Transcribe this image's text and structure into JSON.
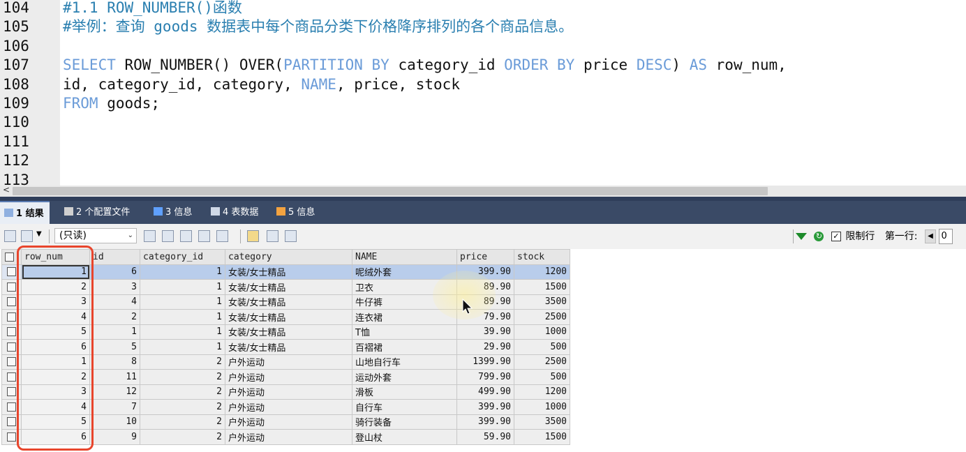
{
  "editor": {
    "lines": [
      {
        "num": "104",
        "parts": [
          {
            "t": "#1.1 ROW_NUMBER()函数",
            "c": "cm"
          }
        ]
      },
      {
        "num": "105",
        "parts": [
          {
            "t": "#举例：查询 goods 数据表中每个商品分类下价格降序排列的各个商品信息。",
            "c": "cm"
          }
        ]
      },
      {
        "num": "106",
        "parts": []
      },
      {
        "num": "107",
        "parts": [
          {
            "t": "SELECT",
            "c": "kw"
          },
          {
            "t": " ROW_NUMBER() OVER(",
            "c": "tx"
          },
          {
            "t": "PARTITION BY",
            "c": "kw"
          },
          {
            "t": " category_id ",
            "c": "tx"
          },
          {
            "t": "ORDER BY",
            "c": "kw"
          },
          {
            "t": " price ",
            "c": "tx"
          },
          {
            "t": "DESC",
            "c": "kw"
          },
          {
            "t": ") ",
            "c": "tx"
          },
          {
            "t": "AS",
            "c": "kw"
          },
          {
            "t": " row_num,",
            "c": "tx"
          }
        ]
      },
      {
        "num": "108",
        "parts": [
          {
            "t": "id, category_id, category, ",
            "c": "tx"
          },
          {
            "t": "NAME",
            "c": "kw"
          },
          {
            "t": ", price, stock",
            "c": "tx"
          }
        ]
      },
      {
        "num": "109",
        "parts": [
          {
            "t": "FROM",
            "c": "kw"
          },
          {
            "t": " goods;",
            "c": "tx"
          }
        ]
      },
      {
        "num": "110",
        "parts": []
      },
      {
        "num": "111",
        "parts": []
      },
      {
        "num": "112",
        "parts": []
      },
      {
        "num": "113",
        "parts": []
      }
    ]
  },
  "tabs": [
    {
      "label": "1 结果",
      "icon": "result-grid-icon",
      "active": true
    },
    {
      "label": "2 个配置文件",
      "icon": "profile-icon",
      "active": false
    },
    {
      "label": "3 信息",
      "icon": "info-icon",
      "active": false
    },
    {
      "label": "4 表数据",
      "icon": "table-data-icon",
      "active": false
    },
    {
      "label": "5 信息",
      "icon": "info-pencil-icon",
      "active": false
    }
  ],
  "toolbar": {
    "mode_select": "(只读)",
    "limit_label": "限制行",
    "first_row_label": "第一行:",
    "first_row_value": "0"
  },
  "grid": {
    "columns": [
      "row_num",
      "id",
      "category_id",
      "category",
      "NAME",
      "price",
      "stock"
    ],
    "rows": [
      [
        "1",
        "6",
        "1",
        "女装/女士精品",
        "呢绒外套",
        "399.90",
        "1200"
      ],
      [
        "2",
        "3",
        "1",
        "女装/女士精品",
        "卫衣",
        "89.90",
        "1500"
      ],
      [
        "3",
        "4",
        "1",
        "女装/女士精品",
        "牛仔裤",
        "89.90",
        "3500"
      ],
      [
        "4",
        "2",
        "1",
        "女装/女士精品",
        "连衣裙",
        "79.90",
        "2500"
      ],
      [
        "5",
        "1",
        "1",
        "女装/女士精品",
        "T恤",
        "39.90",
        "1000"
      ],
      [
        "6",
        "5",
        "1",
        "女装/女士精品",
        "百褶裙",
        "29.90",
        "500"
      ],
      [
        "1",
        "8",
        "2",
        "户外运动",
        "山地自行车",
        "1399.90",
        "2500"
      ],
      [
        "2",
        "11",
        "2",
        "户外运动",
        "运动外套",
        "799.90",
        "500"
      ],
      [
        "3",
        "12",
        "2",
        "户外运动",
        "滑板",
        "499.90",
        "1200"
      ],
      [
        "4",
        "7",
        "2",
        "户外运动",
        "自行车",
        "399.90",
        "1000"
      ],
      [
        "5",
        "10",
        "2",
        "户外运动",
        "骑行装备",
        "399.90",
        "3500"
      ],
      [
        "6",
        "9",
        "2",
        "户外运动",
        "登山杖",
        "59.90",
        "1500"
      ]
    ]
  },
  "colors": {
    "keyword": "#6a9bd8",
    "comment": "#2a7fb0",
    "highlight": "#e8452c",
    "selected_row": "#b9cdeb"
  }
}
